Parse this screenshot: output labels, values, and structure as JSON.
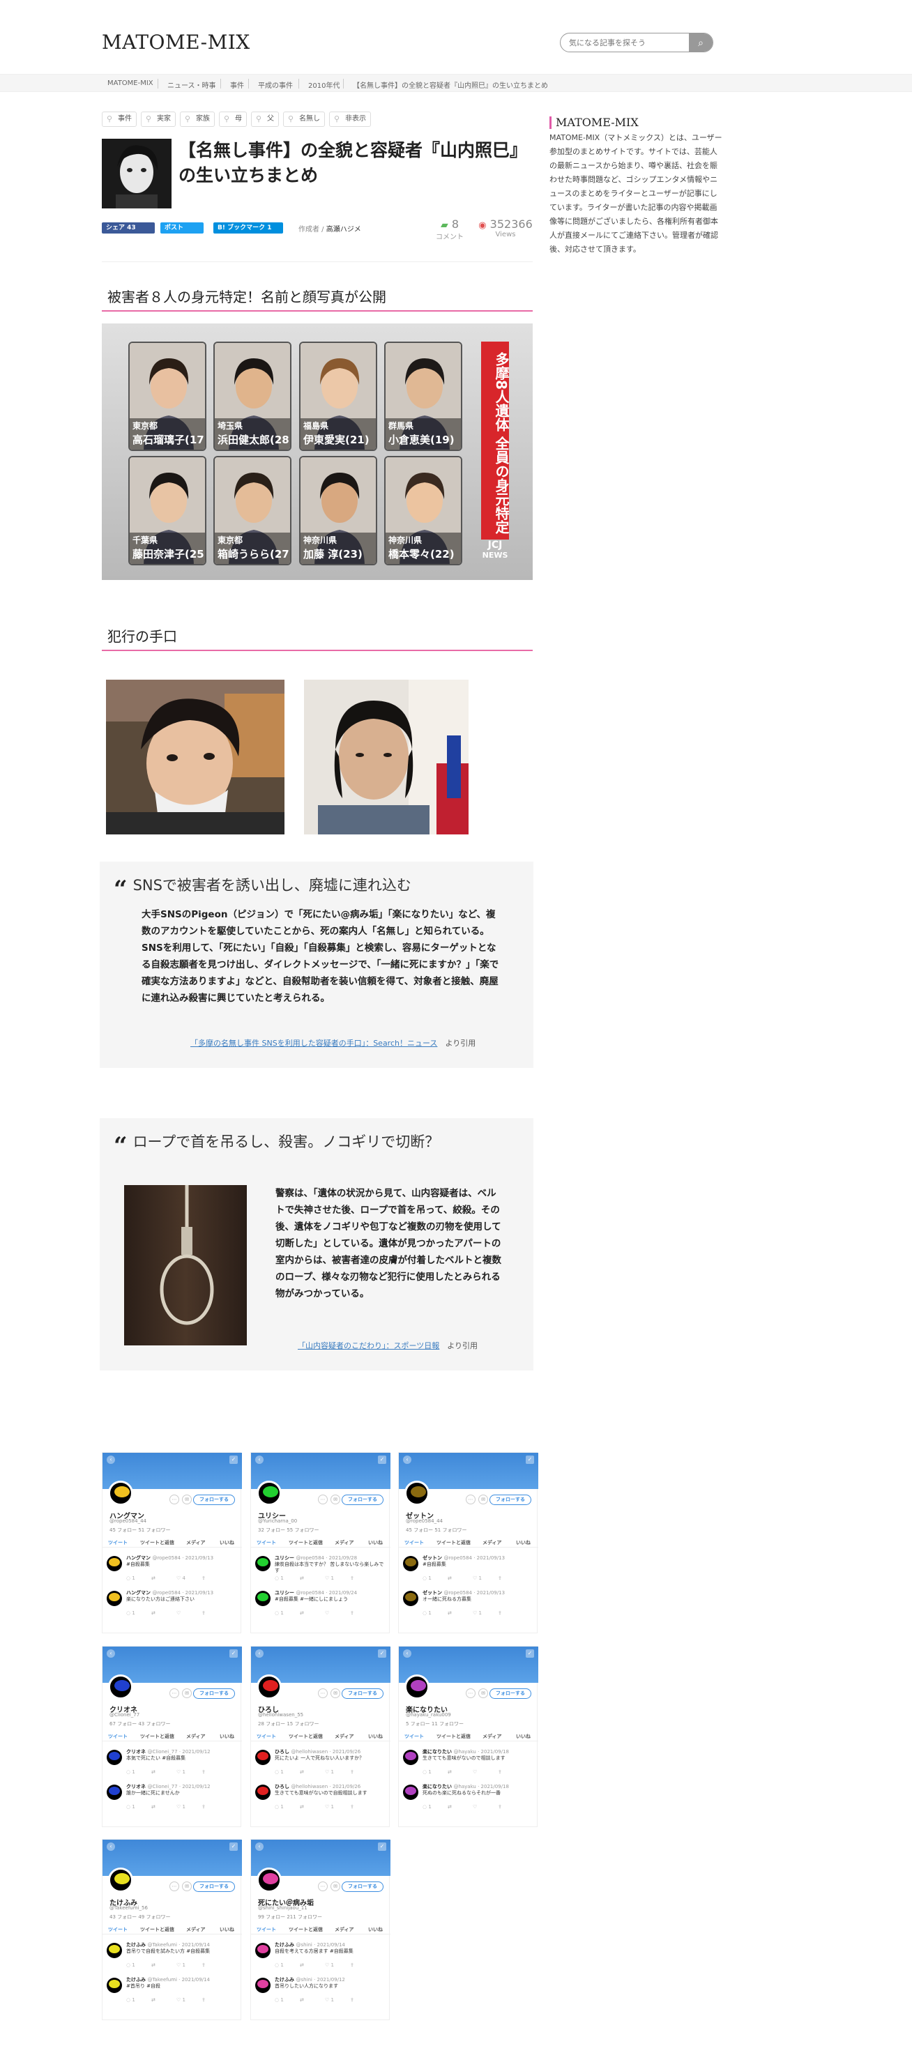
{
  "header": {
    "logo": "MATOME-MIX",
    "search_placeholder": "気になる記事を探そう",
    "search_icon": "search-icon"
  },
  "breadcrumb": [
    "MATOME-MIX",
    "ニュース・時事",
    "事件",
    "平成の事件",
    "2010年代",
    "【名無し事件】の全貌と容疑者『山内照巳』の生い立ちまとめ"
  ],
  "tags": [
    "事件",
    "実家",
    "家族",
    "母",
    "父",
    "名無し",
    "非表示"
  ],
  "article": {
    "title": "【名無し事件】の全貌と容疑者『山内照巳』の生い立ちまとめ",
    "share_fb": "シェア 43",
    "share_tw": "ポスト",
    "share_hb": "B! ブックマーク  1",
    "author_label": "作成者 /",
    "author_name": "高瀬ハジメ",
    "comment_count": "8",
    "comment_label": "コメント",
    "views_count": "352366",
    "views_label": "Views"
  },
  "sidebar": {
    "title": "MATOME-MIX",
    "text": "MATOME-MIX（マトメミックス）とは、ユーザー参加型のまとめサイトです。サイトでは、芸能人の最新ニュースから始まり、噂や裏話、社会を賑わせた時事問題など、ゴシップエンタメ情報やニュースのまとめをライターとユーザーが記事にしています。ライターが書いた記事の内容や掲載画像等に問題がございましたら、各権利所有者御本人が直接メールにてご連絡下さい。管理者が確認後、対応させて頂きます。"
  },
  "sections": {
    "victims_heading": "被害者８人の身元特定！名前と顔写真が公開",
    "method_heading": "犯行の手口"
  },
  "victim_panel": {
    "side_text": "多摩8人遺体 全員の身元特定",
    "brand": "JCJ",
    "brand_sub": "NEWS",
    "victims": [
      {
        "pref": "東京都",
        "name": "高石瑠璃子(17)"
      },
      {
        "pref": "埼玉県",
        "name": "浜田健太郎(28)"
      },
      {
        "pref": "福島県",
        "name": "伊東愛実(21)"
      },
      {
        "pref": "群馬県",
        "name": "小倉恵美(19)"
      },
      {
        "pref": "千葉県",
        "name": "藤田奈津子(25)"
      },
      {
        "pref": "東京都",
        "name": "箱崎うらら(27)"
      },
      {
        "pref": "神奈川県",
        "name": "加藤 淳(23)"
      },
      {
        "pref": "神奈川県",
        "name": "橋本零々(22)"
      }
    ]
  },
  "quote1": {
    "title": "SNSで被害者を誘い出し、廃墟に連れ込む",
    "body": "大手SNSのPigeon（ピジョン）で「死にたい@病み垢」「楽になりたい」など、複数のアカウントを駆使していたことから、死の案内人「名無し」と知られている。SNSを利用して、「死にたい」「自殺」「自殺募集」と検索し、容易にターゲットとなる自殺志願者を見つけ出し、ダイレクトメッセージで、「一緒に死にますか？」「楽で確実な方法ありますよ」などと、自殺幇助者を装い信頼を得て、対象者と接触、廃屋に連れ込み殺害に興じていたと考えられる。",
    "cite_link": "「多摩の名無し事件 SNSを利用した容疑者の手口」：Search！ニュース",
    "cite_suffix": "より引用"
  },
  "quote2": {
    "title": "ロープで首を吊るし、殺害。ノコギリで切断？",
    "body": "警察は、「遺体の状況から見て、山内容疑者は、ベルトで失神させた後、ロープで首を吊って、絞殺。その後、遺体をノコギリや包丁など複数の刃物を使用して切断した」としている。遺体が見つかったアパートの室内からは、被害者達の皮膚が付着したベルトと複数のロープ、様々な刃物など犯行に使用したとみられる物がみつかっている。",
    "cite_link": "「山内容疑者のこだわり」：スポーツ日報",
    "cite_suffix": "より引用"
  },
  "twitter": {
    "follow_label": "フォローする",
    "tabs": [
      "ツイート",
      "ツイートと返信",
      "メディア",
      "いいね"
    ],
    "accounts": [
      {
        "name": "ハングマン",
        "handle": "@rope0584_44",
        "counts": "45 フォロー   51 フォロワー",
        "avatar": "#f0c020",
        "posts": [
          {
            "name": "ハングマン",
            "meta": "@rope0584 · 2021/09/13",
            "text": "#自殺募集",
            "acts": [
              "1",
              "",
              "4",
              ""
            ]
          },
          {
            "name": "ハングマン",
            "meta": "@rope0584 · 2021/09/13",
            "text": "楽になりたい方はご連絡下さい",
            "acts": [
              "1",
              "",
              "",
              ""
            ]
          }
        ]
      },
      {
        "name": "ユリシー",
        "handle": "@Yuricharna_00",
        "counts": "32 フォロー   55 フォロワー",
        "avatar": "#22d030",
        "posts": [
          {
            "name": "ユリシー",
            "meta": "@rope0584 · 2021/09/28",
            "text": "練炭自殺は本当ですか？ 苦しまないなら楽しみです",
            "acts": [
              "1",
              "",
              "1",
              ""
            ]
          },
          {
            "name": "ユリシー",
            "meta": "@rope0584 · 2021/09/24",
            "text": "#自殺募集 #一緒にしにましょう",
            "acts": [
              "1",
              "",
              "",
              ""
            ]
          }
        ]
      },
      {
        "name": "ゼットン",
        "handle": "@rope0584_44",
        "counts": "45 フォロー   51 フォロワー",
        "avatar": "#8a6a10",
        "posts": [
          {
            "name": "ゼットン",
            "meta": "@rope0584 · 2021/09/13",
            "text": "#自殺募集",
            "acts": [
              "1",
              "",
              "1",
              ""
            ]
          },
          {
            "name": "ゼットン",
            "meta": "@rope0584 · 2021/09/13",
            "text": "オー緒に死ねる方募集",
            "acts": [
              "1",
              "",
              "1",
              ""
            ]
          }
        ]
      },
      {
        "name": "クリオネ",
        "handle": "@Clionei_77",
        "counts": "67 フォロー   43 フォロワー",
        "avatar": "#2040d0",
        "posts": [
          {
            "name": "クリオネ",
            "meta": "@Clionei_77 · 2021/09/12",
            "text": "本気で死にたい #自殺募集",
            "acts": [
              "1",
              "",
              "1",
              ""
            ]
          },
          {
            "name": "クリオネ",
            "meta": "@Clionei_77 · 2021/09/12",
            "text": "誰か一緒に死にませんか",
            "acts": [
              "1",
              "",
              "1",
              ""
            ]
          }
        ]
      },
      {
        "name": "ひろし",
        "handle": "@hellohiwasen_55",
        "counts": "28 フォロー   15 フォロワー",
        "avatar": "#e02020",
        "posts": [
          {
            "name": "ひろし",
            "meta": "@hellohiwasen · 2021/09/26",
            "text": "死にたいよ 一人で死ねない人いますか？",
            "acts": [
              "1",
              "",
              "1",
              ""
            ]
          },
          {
            "name": "ひろし",
            "meta": "@hellohiwasen · 2021/09/26",
            "text": "生きてても意味がないので自殺相談します",
            "acts": [
              "1",
              "",
              "1",
              ""
            ]
          }
        ]
      },
      {
        "name": "楽になりたい",
        "handle": "@hayaku_raku009",
        "counts": "5 フォロー   11 フォロワー",
        "avatar": "#b040c0",
        "posts": [
          {
            "name": "楽になりたい",
            "meta": "@hayaku · 2021/09/18",
            "text": "生きてても意味がないので相談します",
            "acts": [
              "1",
              "",
              "",
              ""
            ]
          },
          {
            "name": "楽になりたい",
            "meta": "@hayaku · 2021/09/18",
            "text": "死ぬのも楽に死ねるならそれが一番",
            "acts": [
              "1",
              "",
              "",
              ""
            ]
          }
        ]
      },
      {
        "name": "たけふみ",
        "handle": "@Takeefumi_56",
        "counts": "43 フォロー   49 フォロワー",
        "avatar": "#e8e020",
        "posts": [
          {
            "name": "たけふみ",
            "meta": "@Takeefumi · 2021/09/14",
            "text": "首吊りで自殺を試みたい方 #自殺募集",
            "acts": [
              "1",
              "",
              "1",
              ""
            ]
          },
          {
            "name": "たけふみ",
            "meta": "@Takeefumi · 2021/09/14",
            "text": "#首吊り #自殺",
            "acts": [
              "1",
              "",
              "1",
              ""
            ]
          }
        ]
      },
      {
        "name": "死にたい＠病み垢",
        "handle": "@shini_shinijaou_11",
        "counts": "99 フォロー   211 フォロワー",
        "avatar": "#e040a0",
        "posts": [
          {
            "name": "たけふみ",
            "meta": "@shini · 2021/09/14",
            "text": "自殺を考えてる方居ます #自殺募集",
            "acts": [
              "1",
              "",
              "1",
              ""
            ]
          },
          {
            "name": "たけふみ",
            "meta": "@shini · 2021/09/12",
            "text": "首吊りしたい人方になります",
            "acts": [
              "1",
              "",
              "1",
              ""
            ]
          }
        ]
      }
    ]
  }
}
